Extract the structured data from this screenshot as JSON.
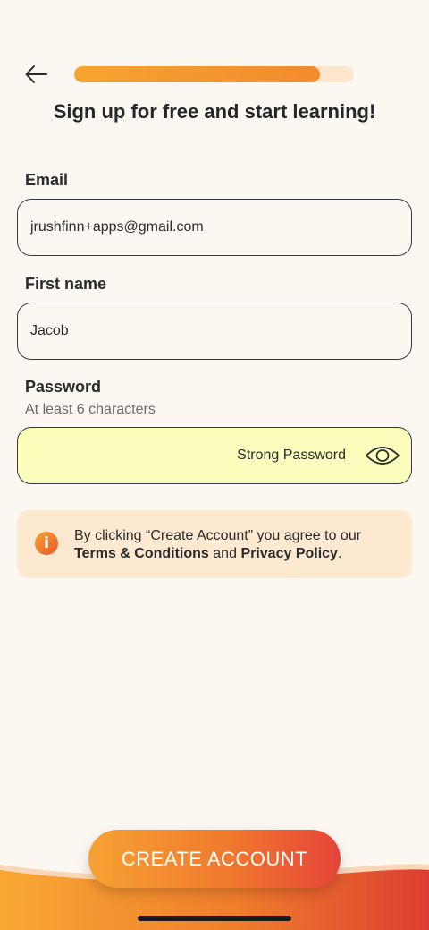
{
  "header": {
    "back_icon": "arrow-left-icon",
    "progress": 0.88,
    "title": "Sign up for free and start learning!"
  },
  "form": {
    "email": {
      "label": "Email",
      "value": "jrushfinn+apps@gmail.com"
    },
    "first_name": {
      "label": "First name",
      "value": "Jacob"
    },
    "password": {
      "label": "Password",
      "hint": "At least 6 characters",
      "strength": "Strong Password",
      "toggle_icon": "eye-icon"
    }
  },
  "notice": {
    "icon": "info-icon",
    "icon_glyph": "i",
    "prefix": "By clicking “Create Account” you agree to our",
    "terms_link": "Terms & Conditions",
    "conjunction": "and",
    "privacy_link": "Privacy Policy",
    "suffix": "."
  },
  "cta": {
    "label": "CREATE ACCOUNT"
  },
  "colors": {
    "background": "#fdf7f1",
    "accent_start": "#f6a233",
    "accent_end": "#e6443a",
    "password_field_bg": "#fbfdbd",
    "notice_bg": "#fde9d0"
  }
}
